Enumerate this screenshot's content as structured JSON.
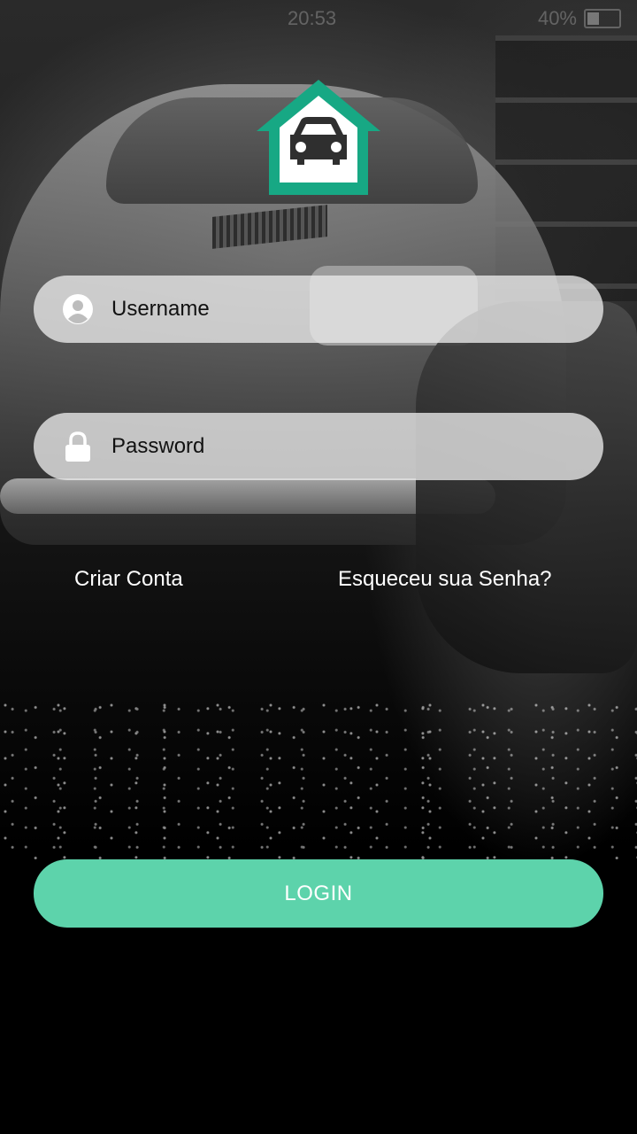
{
  "status_bar": {
    "left_text": "",
    "time": "20:53",
    "battery_percent": "40%"
  },
  "logo": {
    "icon": "garage-car-icon",
    "accent_color": "#17a884"
  },
  "form": {
    "username": {
      "placeholder": "Username",
      "value": "",
      "icon": "user-icon"
    },
    "password": {
      "placeholder": "Password",
      "value": "",
      "icon": "lock-icon"
    }
  },
  "links": {
    "create_account": "Criar Conta",
    "forgot_password": "Esqueceu sua Senha?"
  },
  "login_button": {
    "label": "LOGIN",
    "color": "#5dd3ab"
  }
}
